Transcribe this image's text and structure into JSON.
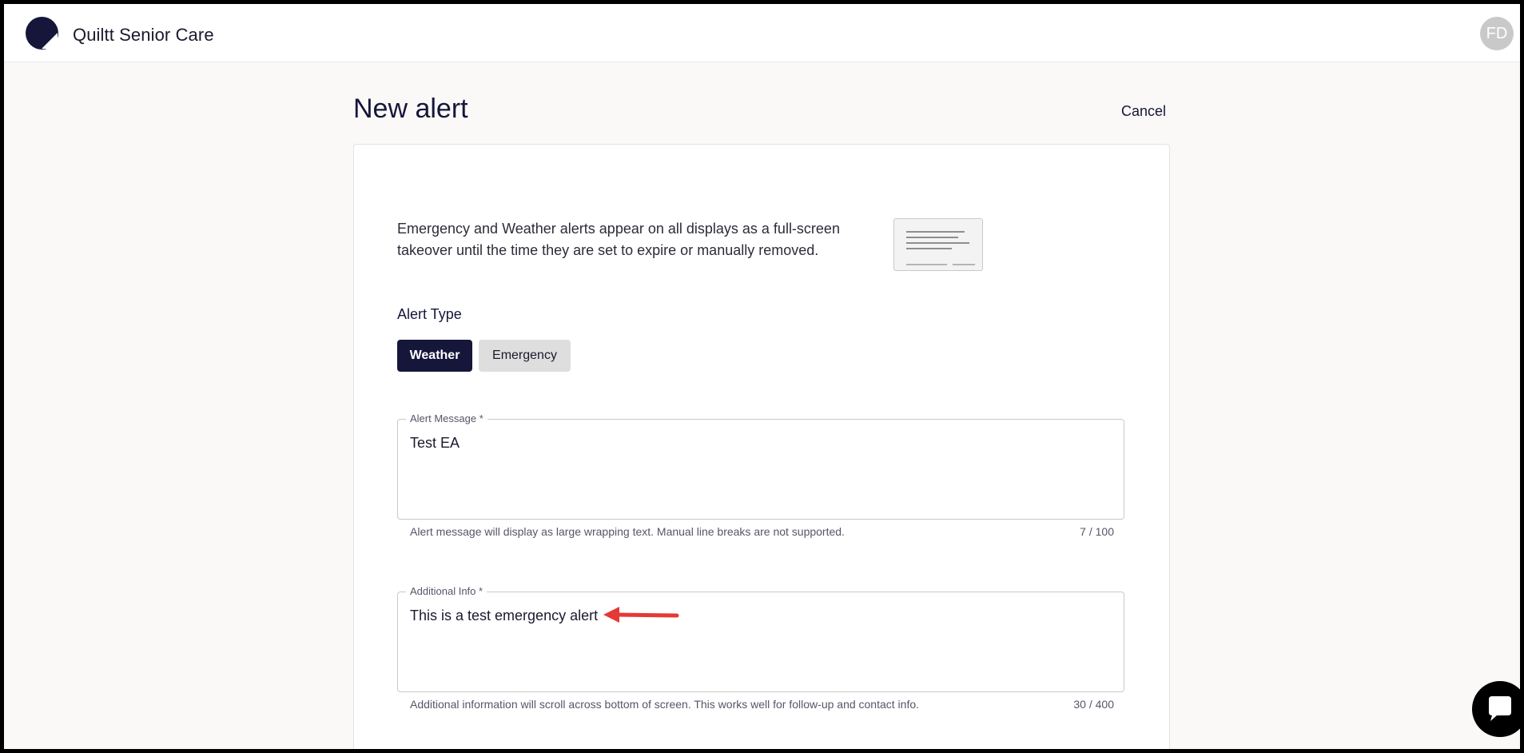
{
  "header": {
    "brand": "Quiltt Senior Care",
    "avatar_initials": "FD"
  },
  "page": {
    "title": "New alert",
    "cancel_label": "Cancel"
  },
  "intro": {
    "text": "Emergency and Weather alerts appear on all displays as a full-screen takeover until the time they are set to expire or manually removed."
  },
  "alert_type": {
    "label": "Alert Type",
    "options": [
      "Weather",
      "Emergency"
    ],
    "selected": "Weather"
  },
  "alert_message": {
    "label": "Alert Message *",
    "value": "Test EA",
    "helper": "Alert message will display as large wrapping text. Manual line breaks are not supported.",
    "counter": "7 / 100"
  },
  "additional_info": {
    "label": "Additional Info *",
    "value": "This is a test emergency alert",
    "helper": "Additional information will scroll across bottom of screen. This works well for follow-up and contact info.",
    "counter": "30 / 400"
  },
  "colors": {
    "primary": "#15163a",
    "annotation_arrow": "#e53935",
    "toggle_inactive": "#dedede"
  },
  "icons": {
    "logo": "quiltt-logo-icon",
    "preview": "display-preview-icon",
    "chat": "chat-bubble-icon",
    "arrow": "annotation-arrow-icon"
  }
}
